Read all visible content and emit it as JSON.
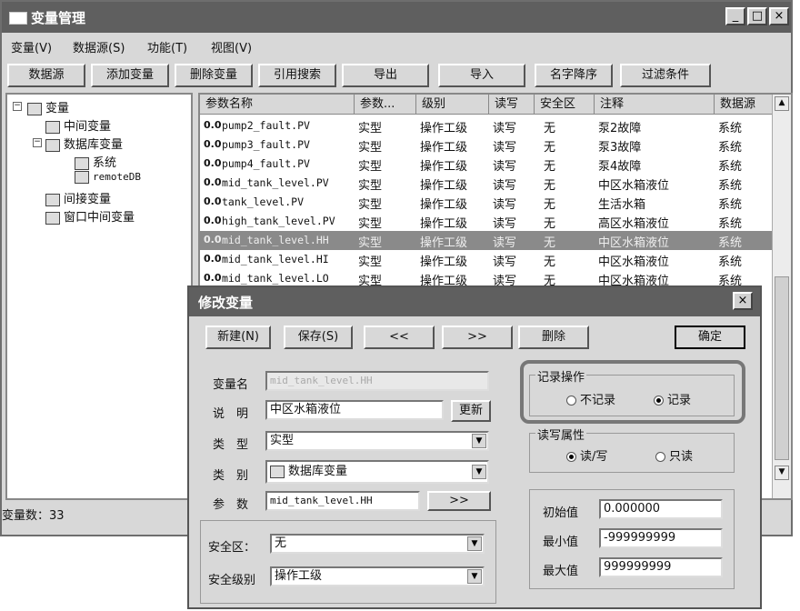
{
  "window": {
    "title": "变量管理",
    "min": "_",
    "max": "□",
    "close": "×"
  },
  "menu": [
    "变量(V)",
    "数据源(S)",
    "功能(T)",
    "视图(V)"
  ],
  "toolbar": [
    "数据源",
    "添加变量",
    "删除变量",
    "引用搜索",
    "导出",
    "导入",
    "名字降序",
    "过滤条件"
  ],
  "tree": {
    "root": "变量",
    "items": [
      "中间变量",
      "数据库变量",
      "系统",
      "remoteDB",
      "间接变量",
      "窗口中间变量"
    ]
  },
  "table": {
    "headers": [
      "参数名称",
      "参数...",
      "级别",
      "读写",
      "安全区",
      "注释",
      "数据源"
    ],
    "rows": [
      [
        "0.0",
        "pump2_fault.PV",
        "实型",
        "操作工级",
        "读写",
        "无",
        "泵2故障",
        "系统"
      ],
      [
        "0.0",
        "pump3_fault.PV",
        "实型",
        "操作工级",
        "读写",
        "无",
        "泵3故障",
        "系统"
      ],
      [
        "0.0",
        "pump4_fault.PV",
        "实型",
        "操作工级",
        "读写",
        "无",
        "泵4故障",
        "系统"
      ],
      [
        "0.0",
        "mid_tank_level.PV",
        "实型",
        "操作工级",
        "读写",
        "无",
        "中区水箱液位",
        "系统"
      ],
      [
        "0.0",
        "tank_level.PV",
        "实型",
        "操作工级",
        "读写",
        "无",
        "生活水箱",
        "系统"
      ],
      [
        "0.0",
        "high_tank_level.PV",
        "实型",
        "操作工级",
        "读写",
        "无",
        "高区水箱液位",
        "系统"
      ],
      [
        "0.0",
        "mid_tank_level.HH",
        "实型",
        "操作工级",
        "读写",
        "无",
        "中区水箱液位",
        "系统"
      ],
      [
        "0.0",
        "mid_tank_level.HI",
        "实型",
        "操作工级",
        "读写",
        "无",
        "中区水箱液位",
        "系统"
      ],
      [
        "0.0",
        "mid_tank_level.LO",
        "实型",
        "操作工级",
        "读写",
        "无",
        "中区水箱液位",
        "系统"
      ]
    ]
  },
  "status": "变量数：33",
  "dialog": {
    "title": "修改变量",
    "close": "×",
    "buttons": {
      "new": "新建(N)",
      "save": "保存(S)",
      "prev": "<<",
      "next": ">>",
      "delete": "删除",
      "ok": "确定"
    },
    "labels": {
      "name": "变量名",
      "desc": "说　明",
      "type": "类　型",
      "category": "类　别",
      "param": "参　数",
      "zone": "安全区：",
      "level": "安全级别"
    },
    "values": {
      "name": "mid_tank_level.HH",
      "desc": "中区水箱液位",
      "type": "实型",
      "category": "数据库变量",
      "param": "mid_tank_level.HH",
      "zone": "无",
      "level": "操作工级"
    },
    "update_btn": "更新",
    "param_btn": ">>",
    "record": {
      "label": "记录操作",
      "opt1": "不记录",
      "opt2": "记录"
    },
    "rw": {
      "label": "读写属性",
      "opt1": "读/写",
      "opt2": "只读"
    },
    "init": {
      "label": "初始值",
      "value": "0.000000"
    },
    "min": {
      "label": "最小值",
      "value": "-999999999"
    },
    "max": {
      "label": "最大值",
      "value": "999999999"
    }
  }
}
